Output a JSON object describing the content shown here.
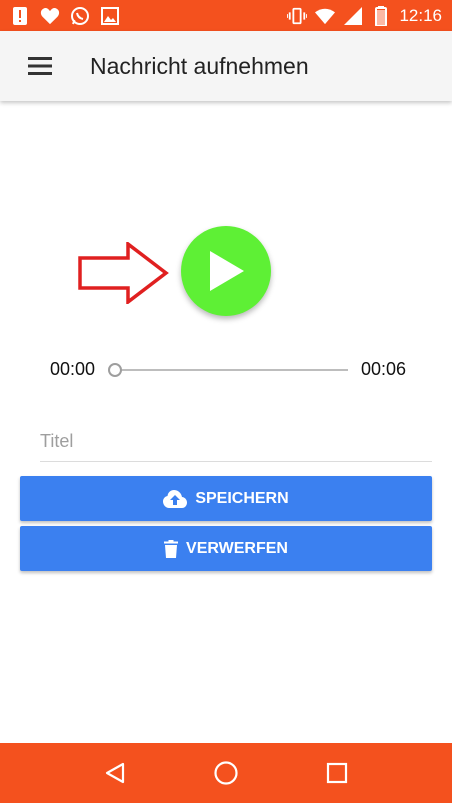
{
  "status_bar": {
    "time": "12:16",
    "icons": [
      "alert-icon",
      "heart-icon",
      "whatsapp-icon",
      "image-icon",
      "vibrate-icon",
      "wifi-icon",
      "signal-icon",
      "battery-icon"
    ],
    "background": "#f4511e"
  },
  "app_bar": {
    "title": "Nachricht aufnehmen",
    "menu_icon": "menu-icon"
  },
  "player": {
    "current_time": "00:00",
    "total_time": "00:06",
    "progress": 0,
    "play_color": "#5ef035",
    "annotation_color": "#e02020"
  },
  "form": {
    "title_placeholder": "Titel",
    "title_value": ""
  },
  "buttons": {
    "save_label": "SPEICHERN",
    "save_icon": "cloud-upload-icon",
    "discard_label": "VERWERFEN",
    "discard_icon": "trash-icon",
    "color": "#3b80f0"
  },
  "nav_bar": {
    "icons": [
      "back-icon",
      "home-icon",
      "recents-icon"
    ]
  }
}
